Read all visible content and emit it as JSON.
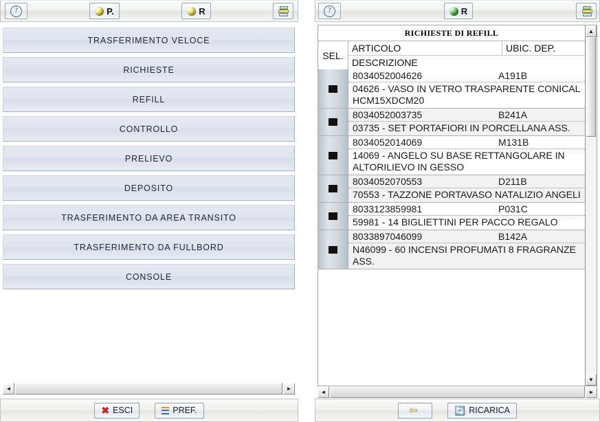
{
  "left": {
    "toolbar": {
      "help_label": "?",
      "buttons": [
        {
          "icon": "yellow-sphere-icon",
          "label": "P."
        },
        {
          "icon": "yellow-sphere-icon",
          "label": "R"
        }
      ],
      "layers_icon": "layers-icon"
    },
    "menu": [
      {
        "label": "TRASFERIMENTO VELOCE"
      },
      {
        "label": "RICHIESTE"
      },
      {
        "label": "REFILL"
      },
      {
        "label": "CONTROLLO"
      },
      {
        "label": "PRELIEVO"
      },
      {
        "label": "DEPOSITO"
      },
      {
        "label": "TRASFERIMENTO DA AREA TRANSITO"
      },
      {
        "label": "TRASFERIMENTO DA FULLBORD"
      },
      {
        "label": "CONSOLE"
      }
    ],
    "scroll": {
      "left_arrow": "◄",
      "right_arrow": "►"
    },
    "actions": [
      {
        "icon": "red-x-icon",
        "label": "ESCI"
      },
      {
        "icon": "list-icon",
        "label": "PREF."
      }
    ]
  },
  "right": {
    "toolbar": {
      "help_label": "?",
      "buttons": [
        {
          "icon": "green-sphere-icon",
          "label": "R"
        }
      ],
      "layers_icon": "layers-icon"
    },
    "grid": {
      "title": "RICHIESTE DI REFILL",
      "headers": {
        "sel": "SEL.",
        "articolo": "ARTICOLO",
        "ubicazione": "UBIC. DEP.",
        "descrizione": "DESCRIZIONE"
      },
      "rows": [
        {
          "articolo": "8034052004626",
          "ubicazione": "A191B",
          "descrizione": "04626 - VASO IN VETRO TRASPARENTE CONICAL HCM15XDCM20"
        },
        {
          "articolo": "8034052003735",
          "ubicazione": "B241A",
          "descrizione": "03735 - SET PORTAFIORI IN PORCELLANA ASS."
        },
        {
          "articolo": "8034052014069",
          "ubicazione": "M131B",
          "descrizione": "14069 - ANGELO SU BASE RETTANGOLARE IN ALTORILIEVO IN GESSO"
        },
        {
          "articolo": "8034052070553",
          "ubicazione": "D211B",
          "descrizione": "70553 - TAZZONE PORTAVASO NATALIZIO ANGELI"
        },
        {
          "articolo": "8033123859981",
          "ubicazione": "P031C",
          "descrizione": "59981 - 14 BIGLIETTINI PER PACCO REGALO"
        },
        {
          "articolo": "8033897046099",
          "ubicazione": "B142A",
          "descrizione": "N46099 - 60 INCENSI PROFUMATI 8 FRAGRANZE ASS."
        }
      ]
    },
    "vscroll": {
      "up_arrow": "▲",
      "down_arrow": "▼"
    },
    "scroll": {
      "left_arrow": "◄",
      "right_arrow": "►"
    },
    "actions": [
      {
        "icon": "back-arrow-icon",
        "label": ""
      },
      {
        "icon": "refresh-icon",
        "label": "RICARICA"
      }
    ]
  }
}
